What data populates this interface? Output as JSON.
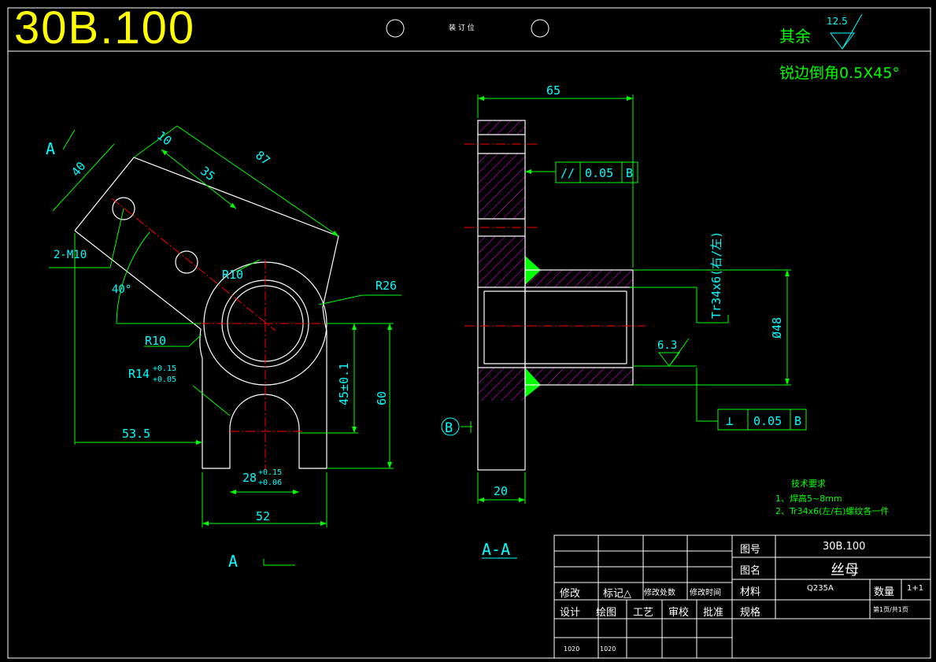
{
  "header": {
    "drawing_number": "30B.100",
    "binding_label": "装 订 位",
    "remain_label": "其余",
    "remain_roughness": "12.5",
    "chamfer_note": "锐边倒角0.5X45°"
  },
  "view_left": {
    "section_mark_top": "A",
    "section_mark_bottom": "A",
    "dim_40": "40",
    "dim_10": "10",
    "dim_35": "35",
    "dim_87": "87",
    "holes": "2-M10",
    "angle": "40°",
    "r10_top": "R10",
    "r26": "R26",
    "r10_left": "R10",
    "r14": "R14",
    "r14_tol_up": "+0.15",
    "r14_tol_dn": "+0.05",
    "dim_45": "45±0.1",
    "dim_60": "60",
    "dim_53_5": "53.5",
    "dim_28": "28",
    "dim_28_tol_up": "+0.15",
    "dim_28_tol_dn": "+0.06",
    "dim_52": "52"
  },
  "view_right": {
    "dim_65": "65",
    "parallel_symbol": "//",
    "parallel_value": "0.05",
    "parallel_datum": "B",
    "thread": "Tr34x6(右/左)",
    "dia_48": "Ø48",
    "roughness_63": "6.3",
    "perp_symbol": "⊥",
    "perp_value": "0.05",
    "perp_datum": "B",
    "datum_b": "B",
    "dim_20": "20",
    "section_label": "A-A"
  },
  "notes": {
    "title": "技术要求",
    "items": [
      "1、焊高5~8mm",
      "2、Tr34x6(左/右)螺纹各一件"
    ]
  },
  "title_block": {
    "drawing_no_label": "图号",
    "drawing_no": "30B.100",
    "name_label": "图名",
    "name": "丝母",
    "material_label": "材料",
    "material": "Q235A",
    "qty_label": "数量",
    "qty": "1+1",
    "spec_label": "规格",
    "page": "第1页/共1页",
    "rev_headers": [
      "修改",
      "标记△",
      "修改处数",
      "修改时间"
    ],
    "sign_headers": [
      "设计",
      "绘图",
      "工艺",
      "审校",
      "批准"
    ],
    "sign_values": [
      "1020",
      "1020"
    ]
  },
  "colors": {
    "outline": "#ffffff",
    "dimension": "#00ff00",
    "dim_text": "#00ffff",
    "center": "#ff0000",
    "hatch": "#ff00ff",
    "title": "#ffff00"
  }
}
